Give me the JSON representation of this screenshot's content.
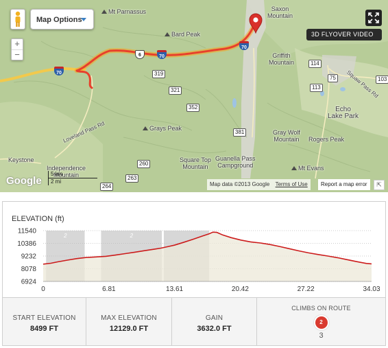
{
  "map": {
    "options_label": "Map Options",
    "flyover_label": "3D FLYOVER VIDEO",
    "google_label": "Google",
    "attribution": "Map data ©2013 Google",
    "terms_label": "Terms of Use",
    "report_error_label": "Report a map error",
    "scale_km": "5 km",
    "scale_mi": "2 mi",
    "labels": {
      "mt_parnassus": "Mt Parnassus",
      "bard_peak": "Bard Peak",
      "saxon_mountain": "Saxon\nMountain",
      "griffith_mountain": "Griffith\nMountain",
      "echo_lake_park": "Echo\nLake Park",
      "grays_peak": "Grays Peak",
      "gray_wolf_mountain": "Gray Wolf\nMountain",
      "rogers_peak": "Rogers Peak",
      "square_top_mountain": "Square Top\nMountain",
      "guanella_pass_campground": "Guanella Pass\nCampground",
      "mt_evans": "Mt Evans",
      "keystone": "Keystone",
      "independence_mountain": "Independence\nMountain",
      "loveland_pass_rd": "Loveland Pass Rd",
      "squaw_pass_rd": "Squaw Pass Rd"
    },
    "route_signs": [
      "319",
      "321",
      "352",
      "381",
      "260",
      "263",
      "264",
      "114",
      "113",
      "75",
      "103"
    ],
    "interstate_labels": [
      "70",
      "70",
      "70"
    ],
    "us_route_label": "6",
    "colors": {
      "route": "#e8402b",
      "route_glow": "#f5a623",
      "marker": "#d9312b"
    }
  },
  "elevation": {
    "title": "ELEVATION (ft)",
    "y_ticks": [
      "11540",
      "10386",
      "9232",
      "8078",
      "6924"
    ],
    "x_ticks": [
      "0",
      "6.81",
      "13.61",
      "20.42",
      "27.22",
      "34.03"
    ],
    "climb_badges": [
      "2",
      "2"
    ]
  },
  "chart_data": {
    "type": "area",
    "title": "ELEVATION (ft)",
    "xlabel": "",
    "ylabel": "",
    "xlim": [
      0,
      34.03
    ],
    "ylim": [
      6924,
      11540
    ],
    "x": [
      0,
      0.8,
      1.5,
      2.5,
      3.5,
      4.5,
      5.5,
      6.5,
      7.5,
      8.5,
      9.5,
      10.5,
      11.5,
      12.2,
      12.9,
      13.6,
      14.5,
      15.5,
      16.5,
      17.2,
      17.6,
      18.0,
      18.6,
      19.5,
      20.5,
      21.5,
      22.5,
      23.5,
      24.5,
      25.5,
      26.5,
      27.5,
      28.5,
      29.5,
      30.5,
      31.5,
      32.5,
      33.5,
      34.03
    ],
    "y": [
      8499,
      8580,
      8700,
      8860,
      9000,
      9100,
      9150,
      9210,
      9320,
      9450,
      9580,
      9720,
      9850,
      9950,
      10080,
      10220,
      10460,
      10750,
      11050,
      11250,
      11400,
      11380,
      11150,
      10900,
      10680,
      10520,
      10420,
      10280,
      10100,
      9900,
      9700,
      9520,
      9370,
      9230,
      9080,
      8900,
      8720,
      8560,
      8520
    ],
    "climbs": [
      {
        "category": "2",
        "start": 0.3,
        "end": 4.3
      },
      {
        "category": "2",
        "start": 6.0,
        "end": 12.3
      },
      {
        "category": "",
        "start": 12.5,
        "end": 17.2
      }
    ],
    "colors": {
      "line": "#cc1b1b",
      "fill": "#ece8d8",
      "climb": "#d0d0d0"
    }
  },
  "stats": {
    "start_label": "START ELEVATION",
    "start_value": "8499 FT",
    "max_label": "MAX ELEVATION",
    "max_value": "12129.0 FT",
    "gain_label": "GAIN",
    "gain_value": "3632.0 FT",
    "climbs_label": "CLIMBS ON ROUTE",
    "climbs_badge": "2",
    "climbs_count": "3"
  }
}
